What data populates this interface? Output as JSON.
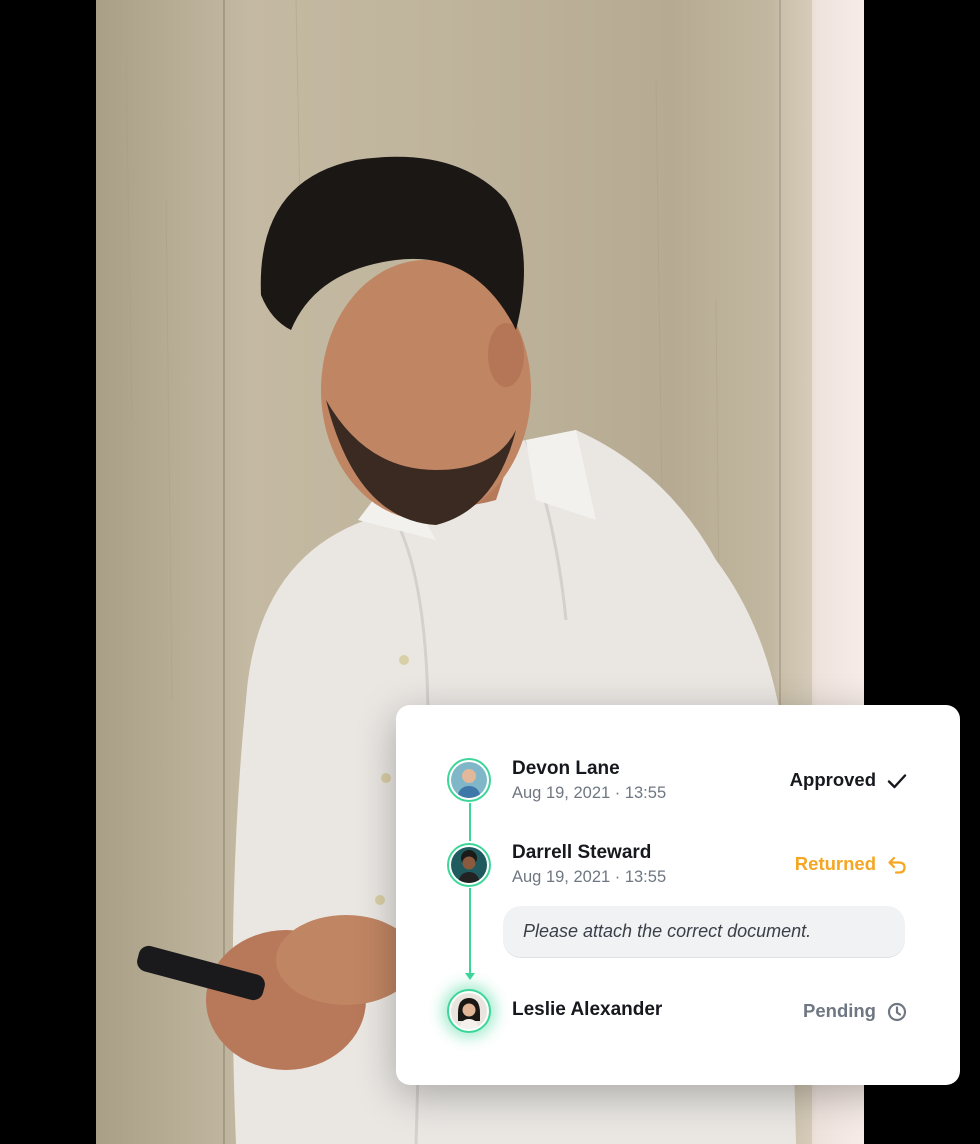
{
  "approval": {
    "steps": [
      {
        "name": "Devon Lane",
        "date": "Aug 19, 2021 · 13:55",
        "status": "Approved",
        "status_icon": "check-icon",
        "status_color": "#16181d"
      },
      {
        "name": "Darrell Steward",
        "date": "Aug 19, 2021 · 13:55",
        "status": "Returned",
        "status_icon": "return-arrow-icon",
        "status_color": "#f5a623",
        "comment": "Please attach the correct document."
      },
      {
        "name": "Leslie Alexander",
        "status": "Pending",
        "status_icon": "clock-icon",
        "status_color": "#6f7783"
      }
    ],
    "accent_color": "#3ed59a"
  }
}
